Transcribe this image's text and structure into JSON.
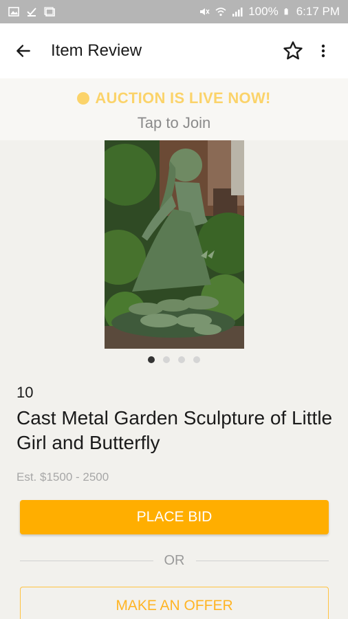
{
  "status_bar": {
    "battery": "100%",
    "time": "6:17 PM"
  },
  "app_bar": {
    "title": "Item Review"
  },
  "banner": {
    "live_text": "AUCTION IS LIVE NOW!",
    "tap_text": "Tap to Join"
  },
  "gallery": {
    "image_count": 4,
    "active_index": 0
  },
  "item": {
    "lot_number": "10",
    "title": "Cast Metal Garden Sculpture of Little Girl and Butterfly",
    "estimate": "Est. $1500 - 2500"
  },
  "actions": {
    "place_bid": "PLACE BID",
    "or": "OR",
    "make_offer": "MAKE AN OFFER"
  },
  "colors": {
    "accent": "#ffae00",
    "live": "#fbd36a"
  }
}
